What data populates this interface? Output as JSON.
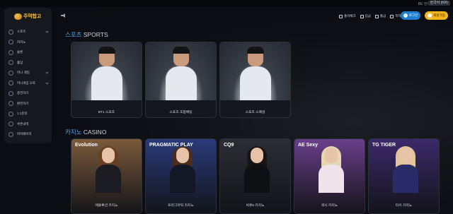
{
  "topbar": {
    "label": "BE 언어",
    "language": "한국어 (KR)"
  },
  "sidebar": {
    "logo_text": "주먹합고",
    "items": [
      {
        "label": "스포츠",
        "icon": "ball-icon",
        "has_chevron": true
      },
      {
        "label": "카지노",
        "icon": "chip-icon",
        "has_chevron": false
      },
      {
        "label": "슬롯",
        "icon": "slot-icon",
        "has_chevron": false
      },
      {
        "label": "홀덤",
        "icon": "cards-icon",
        "has_chevron": false
      },
      {
        "label": "미니 게임",
        "icon": "dice-icon",
        "has_chevron": true
      },
      {
        "label": "미니게임 오토",
        "icon": "auto-icon",
        "has_chevron": true
      },
      {
        "label": "충전하기",
        "icon": "deposit-icon",
        "has_chevron": false
      },
      {
        "label": "환전하기",
        "icon": "withdraw-icon",
        "has_chevron": false
      },
      {
        "label": "1:1문의",
        "icon": "headset-icon",
        "has_chevron": false
      },
      {
        "label": "쿠폰내역",
        "icon": "coupon-icon",
        "has_chevron": false
      },
      {
        "label": "마이페이지",
        "icon": "user-icon",
        "has_chevron": false
      }
    ]
  },
  "header": {
    "links": [
      "출석체크",
      "입금",
      "출금",
      "쪽지"
    ],
    "login_label": "로그인",
    "join_label": "회원가입"
  },
  "sports_section": {
    "title_ko": "스포츠",
    "title_en": "SPORTS",
    "cards": [
      {
        "label": "BT1 스포츠"
      },
      {
        "label": "스포츠 조합배팅"
      },
      {
        "label": "스포츠 스페셜"
      }
    ]
  },
  "casino_section": {
    "title_ko": "카지노",
    "title_en": "CASINO",
    "cards": [
      {
        "label": "에볼루션 카지노",
        "brand": "Evolution",
        "bg": "#7a5a3a",
        "hair": "#6b3e24",
        "outfit": "#1b1b22"
      },
      {
        "label": "프라그마틱 카지노",
        "brand": "PRAGMATIC PLAY",
        "bg": "#2a3a7a",
        "hair": "#4a2d1c",
        "outfit": "#141826"
      },
      {
        "label": "써큐9 카지노",
        "brand": "CQ9",
        "bg": "#2a2d33",
        "hair": "#1c1410",
        "outfit": "#0f1014"
      },
      {
        "label": "섹시 카지노",
        "brand": "AE Sexy",
        "bg": "#6a3f8a",
        "hair": "#e8d6b0",
        "outfit": "#f0e4ea"
      },
      {
        "label": "타이 카지노",
        "brand": "TG TIGER",
        "bg": "#3b2a6a",
        "hair": "#e2c39a",
        "outfit": "#2a2c6a"
      }
    ]
  }
}
